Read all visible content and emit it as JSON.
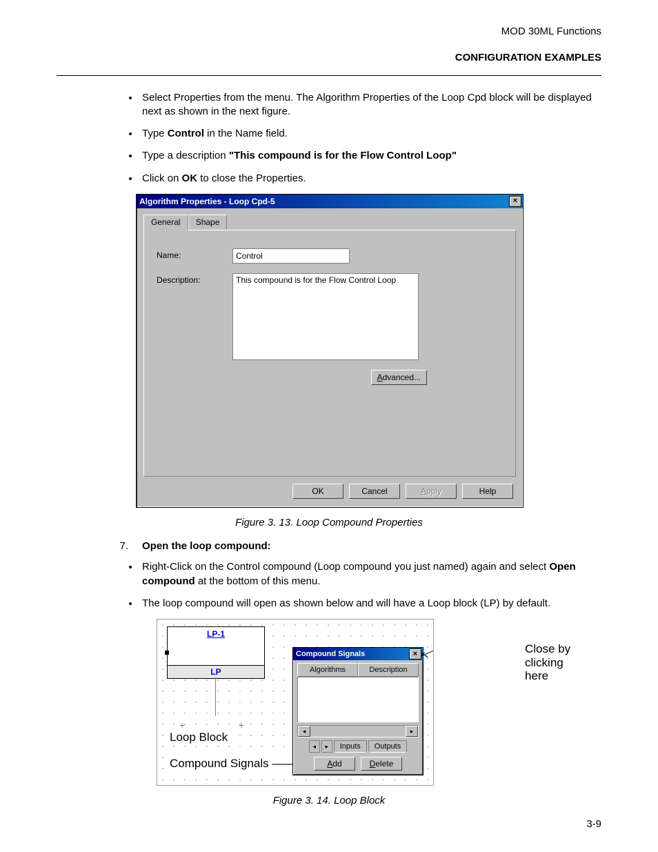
{
  "header": {
    "line1": "MOD 30ML Functions",
    "line2": "CONFIGURATION EXAMPLES"
  },
  "bullets_top": {
    "b1a": "Select Properties from the menu. The Algorithm Properties of the Loop Cpd block will be displayed next as shown in the next figure.",
    "b2_pre": "Type ",
    "b2_bold": "Control",
    "b2_post": " in the Name field.",
    "b3_pre": "Type a description ",
    "b3_bold": "\"This compound is for the Flow Control Loop\"",
    "b4_pre": "Click on ",
    "b4_bold": "OK",
    "b4_post": " to close the Properties."
  },
  "dialog": {
    "title": "Algorithm Properties - Loop Cpd-5",
    "close_x": "×",
    "tabs": {
      "general": "General",
      "shape": "Shape"
    },
    "labels": {
      "name": "Name:",
      "description": "Description:"
    },
    "values": {
      "name": "Control",
      "description": "This compound is for the Flow Control Loop"
    },
    "buttons": {
      "advanced": "Advanced...",
      "ok": "OK",
      "cancel": "Cancel",
      "apply": "Apply",
      "help": "Help"
    }
  },
  "captions": {
    "fig13": "Figure 3. 13. Loop Compound Properties",
    "fig14": "Figure 3. 14. Loop Block"
  },
  "step7": {
    "num": "7.",
    "title": "Open the loop compound:",
    "b1_pre": "Right-Click on the Control compound (Loop compound you just named) again and select ",
    "b1_bold": "Open compound",
    "b1_post": " at the bottom of this menu.",
    "b2": "The loop compound will open as shown below and will have a Loop block (LP) by default."
  },
  "editor": {
    "lp_title": "LP-1",
    "lp_footer": "LP",
    "loop_block_label": "Loop Block",
    "compound_signals_label": "Compound Signals ——",
    "palette": {
      "title": "Compound Signals",
      "close_x": "×",
      "cols": {
        "algorithms": "Algorithms",
        "description": "Description"
      },
      "tabs": {
        "inputs": "Inputs",
        "outputs": "Outputs"
      },
      "nav": {
        "left": "◂",
        "right": "▸"
      },
      "scroll": {
        "left": "◂",
        "right": "▸"
      },
      "buttons": {
        "add": "Add",
        "delete": "Delete"
      }
    },
    "callout": {
      "l1": "Close by",
      "l2": "clicking",
      "l3": "here"
    },
    "cursor": "↖"
  },
  "page_number": "3-9"
}
